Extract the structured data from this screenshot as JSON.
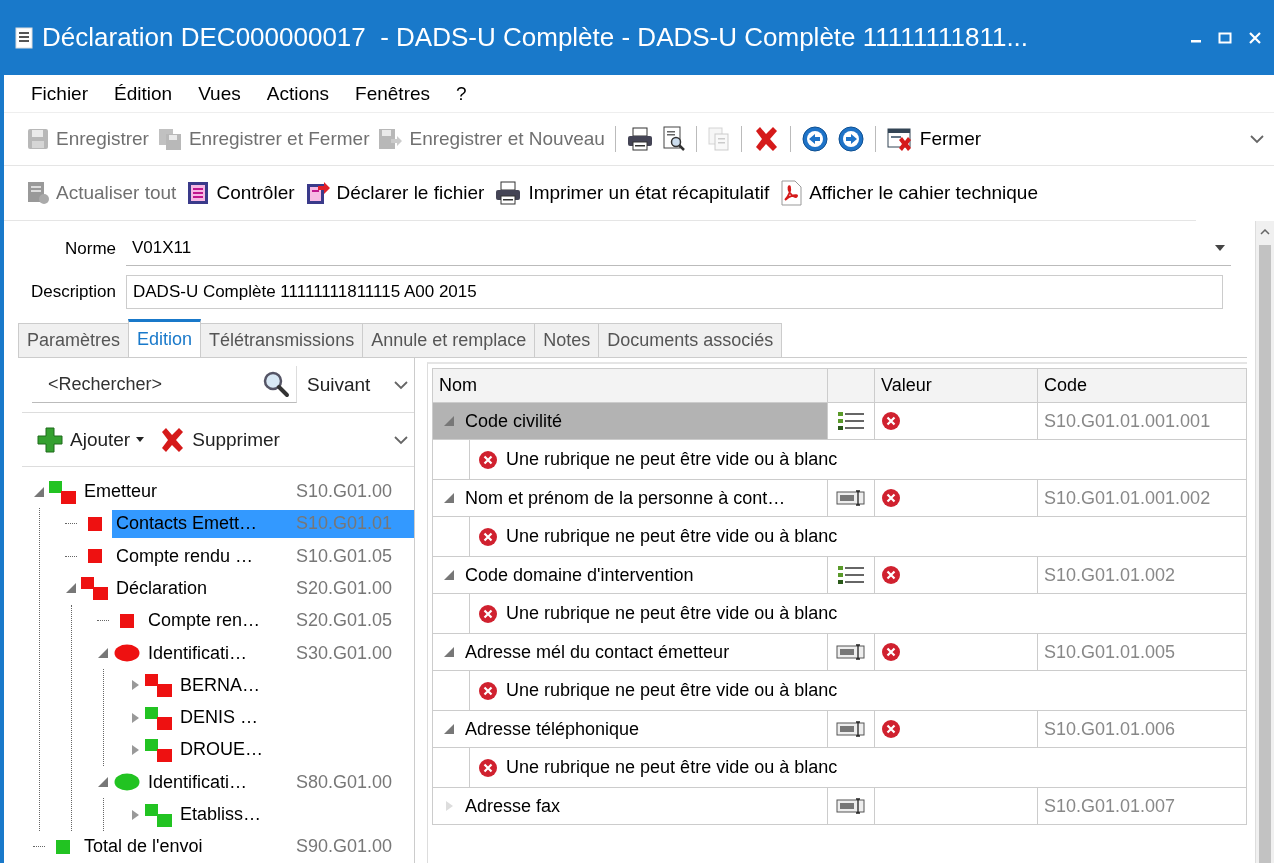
{
  "window": {
    "title": "Déclaration DEC000000017  - DADS-U Complète - DADS-U Complète 11111111811..."
  },
  "menu": [
    "Fichier",
    "Édition",
    "Vues",
    "Actions",
    "Fenêtres",
    "?"
  ],
  "toolbar": [
    {
      "kind": "button",
      "label": "Enregistrer",
      "disabled": true
    },
    {
      "kind": "button",
      "label": "Enregistrer et Fermer",
      "disabled": true
    },
    {
      "kind": "button",
      "label": "Enregistrer et Nouveau",
      "disabled": true
    },
    {
      "kind": "separator"
    },
    {
      "kind": "icon",
      "disabled": false
    },
    {
      "kind": "icon",
      "disabled": false
    },
    {
      "kind": "separator"
    },
    {
      "kind": "icon",
      "disabled": true
    },
    {
      "kind": "separator"
    },
    {
      "kind": "icon",
      "disabled": false
    },
    {
      "kind": "separator"
    },
    {
      "kind": "icon",
      "disabled": false
    },
    {
      "kind": "icon",
      "disabled": false
    },
    {
      "kind": "separator"
    },
    {
      "kind": "button",
      "label": "Fermer",
      "disabled": false
    }
  ],
  "actions": [
    {
      "label": "Actualiser tout",
      "disabled": true
    },
    {
      "label": "Contrôler",
      "disabled": false
    },
    {
      "label": "Déclarer le fichier",
      "disabled": false
    },
    {
      "label": "Imprimer un état récapitulatif",
      "disabled": false
    },
    {
      "label": "Afficher le cahier technique",
      "disabled": false
    }
  ],
  "fields": [
    {
      "label": "Norme",
      "value": "V01X11",
      "kind": "dropdown"
    },
    {
      "label": "Description",
      "value": "DADS-U Complète 11111111811115 A00 2015",
      "kind": "text"
    }
  ],
  "tabs": [
    {
      "label": "Paramètres",
      "selected": false
    },
    {
      "label": "Edition",
      "selected": true
    },
    {
      "label": "Télétransmissions",
      "selected": false
    },
    {
      "label": "Annule et remplace",
      "selected": false
    },
    {
      "label": "Notes",
      "selected": false
    },
    {
      "label": "Documents associés",
      "selected": false
    }
  ],
  "search": {
    "placeholder": "<Rechercher>",
    "next": "Suivant"
  },
  "tree_toolbar": {
    "add": "Ajouter",
    "remove": "Supprimer"
  },
  "tree": [
    {
      "label": "Emetteur",
      "code": "S10.G01.00",
      "kind": "pair",
      "marks": [
        {
          "color": "#22c322"
        },
        {
          "color": "#ee1111"
        }
      ],
      "expanded": true,
      "selected": false,
      "children": [
        {
          "label": "Contacts Emett…",
          "code": "S10.G01.01",
          "kind": "square",
          "marks": [
            {
              "color": "#ee1111"
            }
          ],
          "selected": true
        },
        {
          "label": "Compte rendu …",
          "code": "S10.G01.05",
          "kind": "square",
          "marks": [
            {
              "color": "#ee1111"
            }
          ],
          "selected": false
        },
        {
          "label": "Déclaration",
          "code": "S20.G01.00",
          "kind": "pair",
          "marks": [
            {
              "color": "#ee1111"
            },
            {
              "color": "#ee1111"
            }
          ],
          "expanded": true,
          "selected": false,
          "children": [
            {
              "label": "Compte ren…",
              "code": "S20.G01.05",
              "kind": "square",
              "marks": [
                {
                  "color": "#ee1111"
                }
              ],
              "selected": false
            },
            {
              "label": "Identificati…",
              "code": "S30.G01.00",
              "kind": "oval",
              "marks": [
                {
                  "color": "#ee1111"
                }
              ],
              "expanded": true,
              "selected": false,
              "children": [
                {
                  "label": "BERNA…",
                  "kind": "pair",
                  "marks": [
                    {
                      "color": "#ee1111"
                    },
                    {
                      "color": "#ee1111"
                    }
                  ],
                  "expanded": false,
                  "selected": false
                },
                {
                  "label": "DENIS …",
                  "kind": "pair",
                  "marks": [
                    {
                      "color": "#22c322"
                    },
                    {
                      "color": "#ee1111"
                    }
                  ],
                  "expanded": false,
                  "selected": false
                },
                {
                  "label": "DROUE…",
                  "kind": "pair",
                  "marks": [
                    {
                      "color": "#22c322"
                    },
                    {
                      "color": "#ee1111"
                    }
                  ],
                  "expanded": false,
                  "selected": false
                }
              ]
            },
            {
              "label": "Identificati…",
              "code": "S80.G01.00",
              "kind": "oval",
              "marks": [
                {
                  "color": "#22c322"
                }
              ],
              "expanded": true,
              "selected": false,
              "children": [
                {
                  "label": "Etabliss…",
                  "kind": "pair",
                  "marks": [
                    {
                      "color": "#22c322"
                    },
                    {
                      "color": "#22c322"
                    }
                  ],
                  "expanded": false,
                  "selected": false
                }
              ]
            }
          ]
        }
      ]
    },
    {
      "label": "Total de l'envoi",
      "code": "S90.G01.00",
      "kind": "square",
      "marks": [
        {
          "color": "#22c322"
        }
      ],
      "selected": false
    }
  ],
  "grid": {
    "columns": [
      "Nom",
      "Valeur",
      "Code"
    ],
    "rows": [
      {
        "kind": "field",
        "name": "Code civilité",
        "type_icon": {
          "kind": "list"
        },
        "error": true,
        "code": "S10.G01.01.001.001",
        "expanded": true,
        "selected": true
      },
      {
        "kind": "message",
        "text": "Une rubrique ne peut être vide ou à blanc"
      },
      {
        "kind": "field",
        "name": "Nom et prénom de la personne à cont…",
        "type_icon": {
          "kind": "text"
        },
        "error": true,
        "code": "S10.G01.01.001.002",
        "expanded": true,
        "selected": false
      },
      {
        "kind": "message",
        "text": "Une rubrique ne peut être vide ou à blanc"
      },
      {
        "kind": "field",
        "name": "Code domaine d'intervention",
        "type_icon": {
          "kind": "list"
        },
        "error": true,
        "code": "S10.G01.01.002",
        "expanded": true,
        "selected": false
      },
      {
        "kind": "message",
        "text": "Une rubrique ne peut être vide ou à blanc"
      },
      {
        "kind": "field",
        "name": "Adresse mél du contact émetteur",
        "type_icon": {
          "kind": "text"
        },
        "error": true,
        "code": "S10.G01.01.005",
        "expanded": true,
        "selected": false
      },
      {
        "kind": "message",
        "text": "Une rubrique ne peut être vide ou à blanc"
      },
      {
        "kind": "field",
        "name": "Adresse téléphonique",
        "type_icon": {
          "kind": "text"
        },
        "error": true,
        "code": "S10.G01.01.006",
        "expanded": true,
        "selected": false
      },
      {
        "kind": "message",
        "text": "Une rubrique ne peut être vide ou à blanc"
      },
      {
        "kind": "field",
        "name": "Adresse fax",
        "type_icon": {
          "kind": "text"
        },
        "error": false,
        "code": "S10.G01.01.007",
        "expanded": false,
        "selected": false
      }
    ]
  }
}
